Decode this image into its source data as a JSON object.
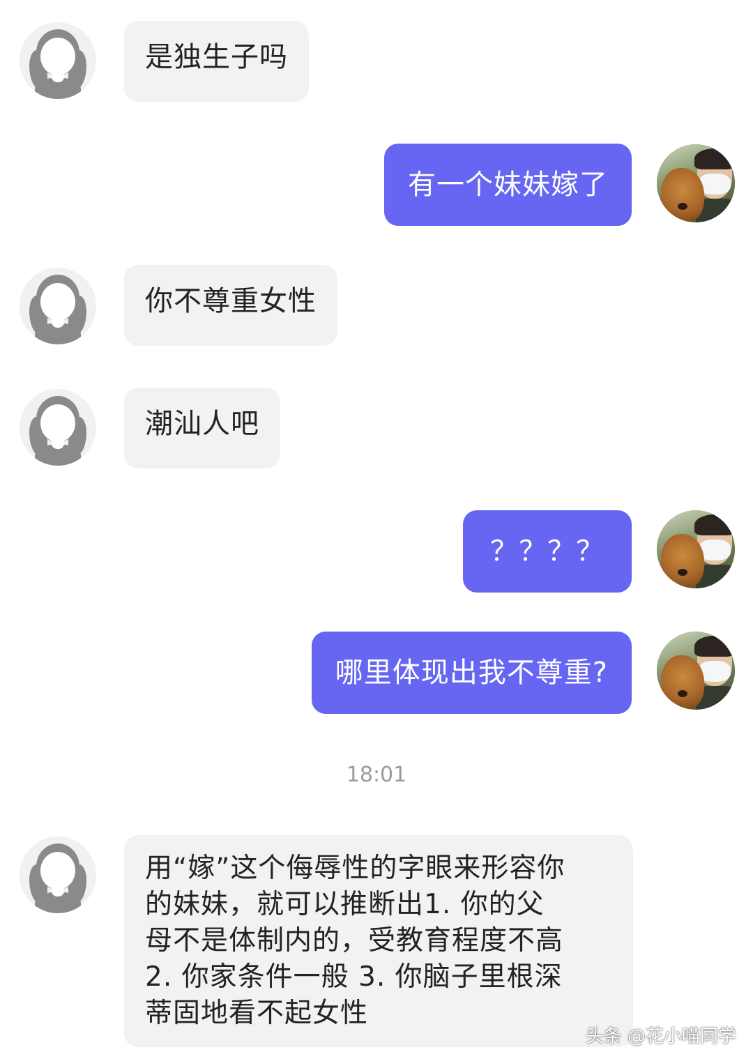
{
  "messages": [
    {
      "side": "in",
      "text": "是独生子吗"
    },
    {
      "side": "out",
      "text": "有一个妹妹嫁了"
    },
    {
      "side": "in",
      "text": "你不尊重女性"
    },
    {
      "side": "in",
      "text": "潮汕人吧"
    },
    {
      "side": "out",
      "text": "？？？？"
    },
    {
      "side": "out",
      "text": "哪里体现出我不尊重?"
    },
    {
      "side": "in",
      "text": "用“嫁”这个侮辱性的字眼来形容你的妹妹，就可以推断出1. 你的父母不是体制内的，受教育程度不高 2. 你家条件一般 3. 你脑子里根深蒂固地看不起女性"
    }
  ],
  "timestamp": "18:01",
  "long_message_lines": [
    "用“嫁”这个侮辱性的字眼来形容你",
    "的妹妹，就可以推断出1. 你的父",
    "母不是体制内的，受教育程度不高",
    "2. 你家条件一般 3. 你脑子里根深",
    "蒂固地看不起女性"
  ],
  "watermark": "头条 @花小喵同学",
  "colors": {
    "sent_bubble": "#6666f2",
    "received_bubble": "#f2f2f2",
    "timestamp": "#9a9a9a"
  },
  "icons": {
    "received_avatar": "default-female-avatar-icon",
    "sent_avatar": "user-photo-avatar-with-dog"
  }
}
